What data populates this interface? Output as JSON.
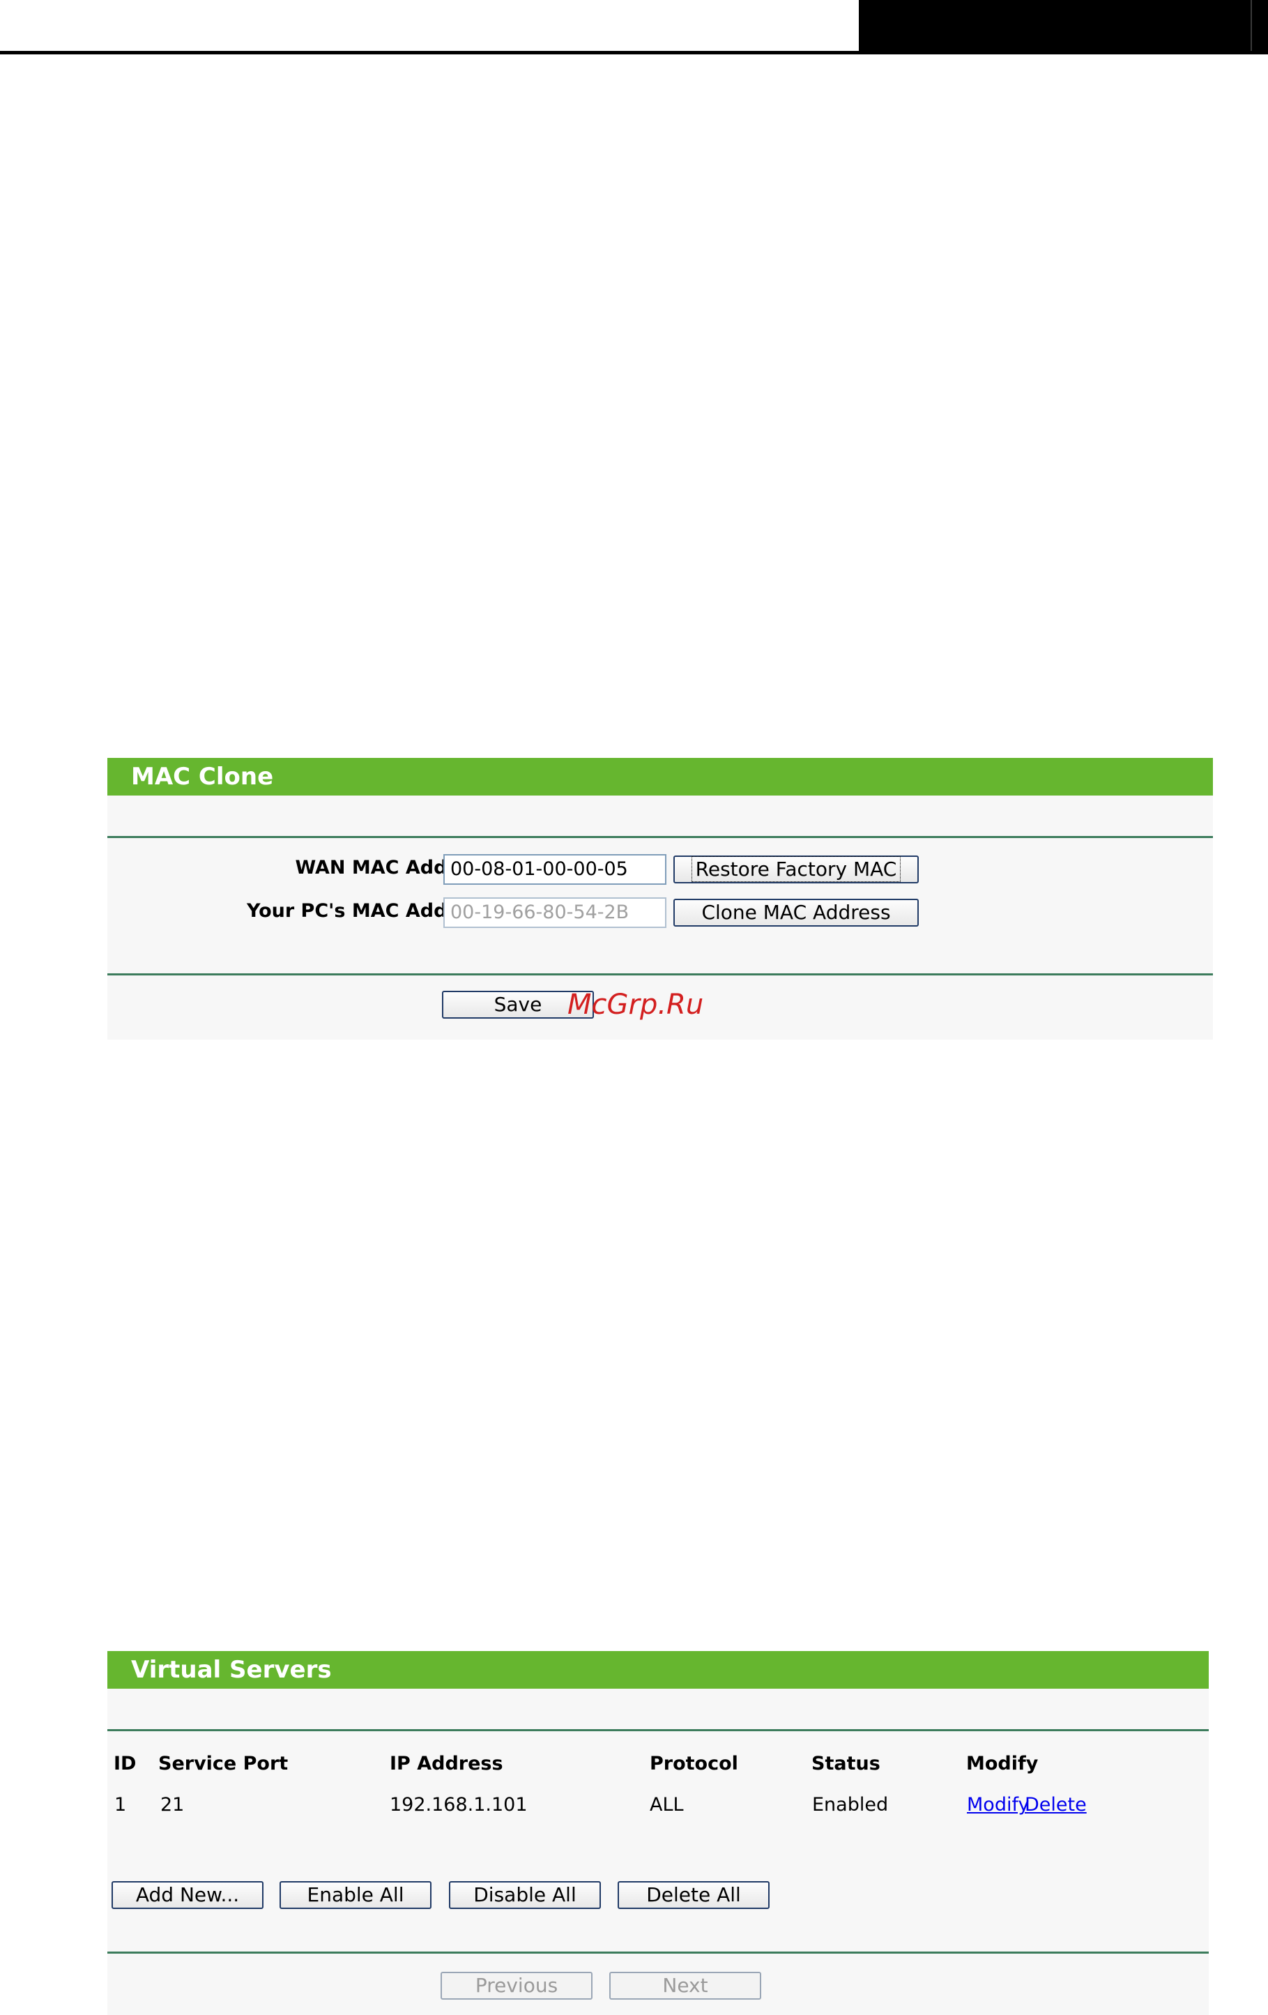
{
  "mac_clone": {
    "title": "MAC Clone",
    "wan_mac_label": "WAN MAC Address:",
    "wan_mac_value": "00-08-01-00-00-05",
    "restore_button": "Restore Factory MAC",
    "pc_mac_label": "Your PC's MAC Address:",
    "pc_mac_value": "00-19-66-80-54-2B",
    "clone_button": "Clone MAC Address",
    "save_button": "Save"
  },
  "watermark": "McGrp.Ru",
  "virtual_servers": {
    "title": "Virtual Servers",
    "columns": [
      "ID",
      "Service Port",
      "IP Address",
      "Protocol",
      "Status",
      "Modify"
    ],
    "rows": [
      {
        "id": "1",
        "service_port": "21",
        "ip_address": "192.168.1.101",
        "protocol": "ALL",
        "status": "Enabled",
        "modify_link": "Modify",
        "delete_link": "Delete"
      }
    ],
    "add_new_button": "Add New...",
    "enable_all_button": "Enable All",
    "disable_all_button": "Disable All",
    "delete_all_button": "Delete All",
    "previous_button": "Previous",
    "next_button": "Next"
  }
}
